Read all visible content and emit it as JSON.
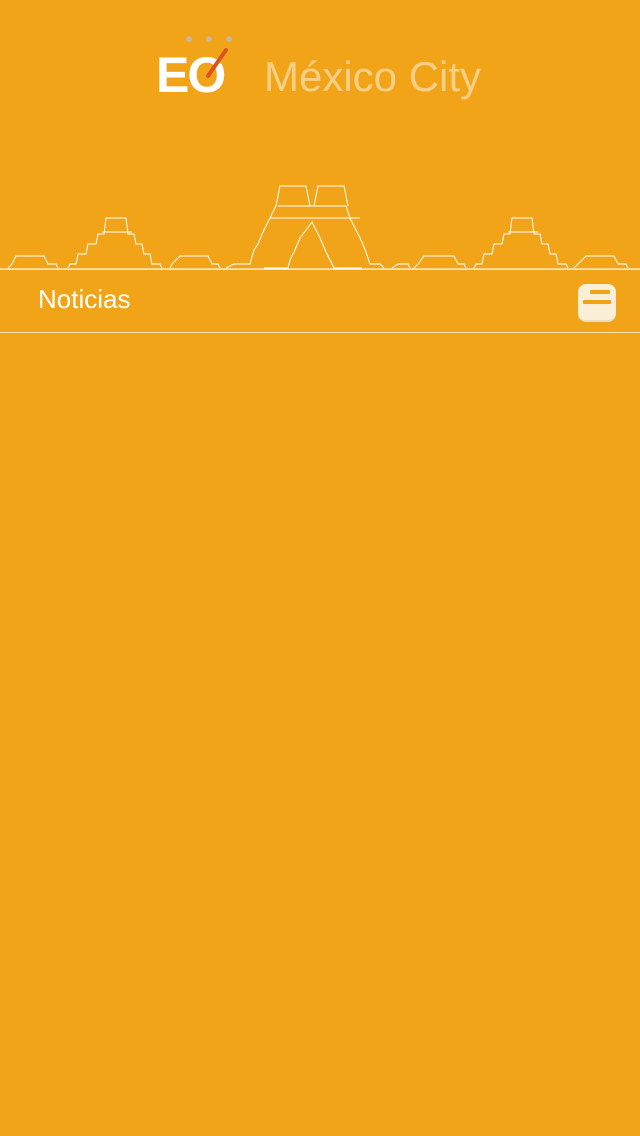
{
  "app": {
    "logo_text": "EO",
    "city_title": "México City"
  },
  "nav": {
    "title": "Noticias",
    "menu_icon": "menu-icon"
  },
  "colors": {
    "background": "#F2A418",
    "title_faded": "#F8CF86",
    "logo_accent": "#D9541E",
    "line": "#FBE3B4"
  }
}
